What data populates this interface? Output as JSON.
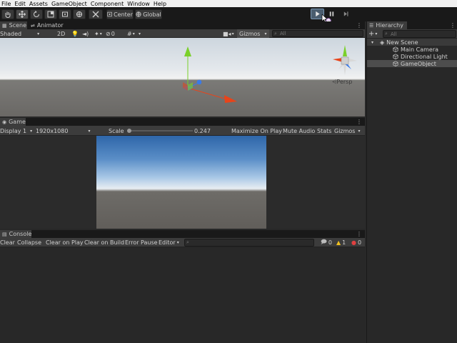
{
  "menu": [
    "File",
    "Edit",
    "Assets",
    "GameObject",
    "Component",
    "Window",
    "Help"
  ],
  "toolbar": {
    "pivot_label": "Center",
    "space_label": "Global"
  },
  "scene": {
    "tabs": [
      "Scene",
      "Animator"
    ],
    "shading_mode": "Shaded",
    "mode_2d": "2D",
    "fx_count": "0",
    "gizmos_label": "Gizmos",
    "search_placeholder": "All",
    "persp_label": "Persp",
    "gizmo_axes": {
      "x": "x",
      "y": "y",
      "z": "z"
    }
  },
  "game": {
    "tab": "Game",
    "display": "Display 1",
    "resolution": "1920x1080",
    "scale_label": "Scale",
    "scale_value": "0.247",
    "maximize_label": "Maximize On Play",
    "mute_label": "Mute Audio",
    "stats_label": "Stats",
    "gizmos_label": "Gizmos"
  },
  "console": {
    "tab": "Console",
    "buttons": [
      "Clear",
      "Collapse",
      "Clear on Play",
      "Clear on Build",
      "Error Pause",
      "Editor"
    ],
    "counts": {
      "info": "0",
      "warning": "1",
      "error": "0"
    }
  },
  "hierarchy": {
    "tab": "Hierarchy",
    "search_placeholder": "All",
    "scene_name": "New Scene",
    "items": [
      "Main Camera",
      "Directional Light",
      "GameObject"
    ]
  },
  "colors": {
    "editor_bg": "#282828",
    "panel_bg": "#3c3c3c",
    "toolbar_bg": "#191919",
    "selection": "#4d4d4d",
    "axis_x": "#e8441a",
    "axis_y": "#7ad02a",
    "axis_z": "#3a7ae8"
  }
}
